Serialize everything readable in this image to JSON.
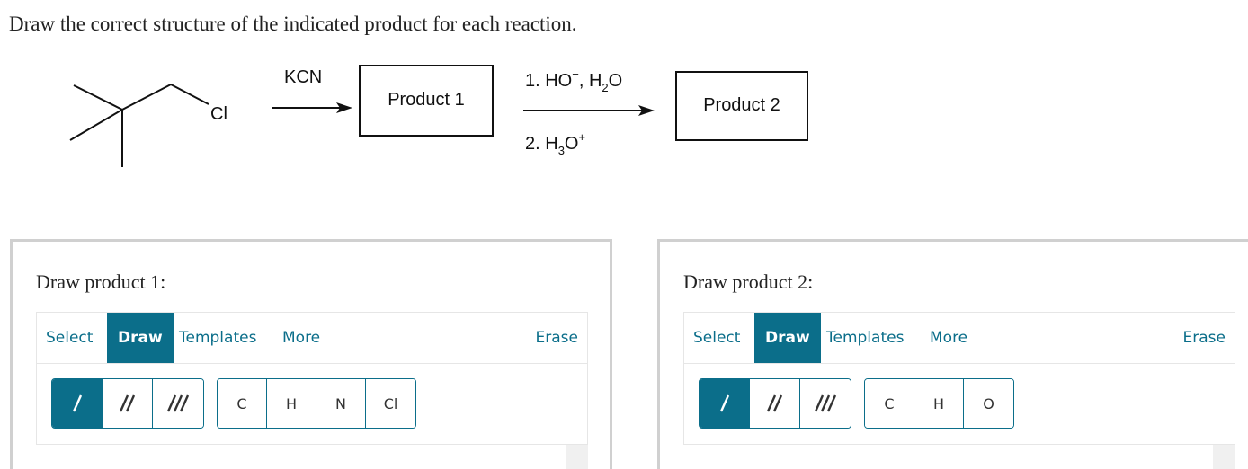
{
  "question": "Draw the correct structure of the indicated product for each reaction.",
  "scheme": {
    "reagent1": "KCN",
    "product1_label": "Product 1",
    "step1_prefix": "1. HO",
    "step1_charge": "−",
    "step1_mid": ", H",
    "step1_sub": "2",
    "step1_end": "O",
    "step2_prefix": "2. H",
    "step2_sub": "3",
    "step2_end": "O",
    "step2_charge": "+",
    "product2_label": "Product 2",
    "chlorine": "Cl"
  },
  "panel1": {
    "title": "Draw product 1:",
    "tabs": {
      "select": "Select",
      "draw": "Draw",
      "templates": "Templates",
      "more": "More",
      "erase": "Erase"
    },
    "atoms": [
      "C",
      "H",
      "N",
      "Cl"
    ]
  },
  "panel2": {
    "title": "Draw product 2:",
    "tabs": {
      "select": "Select",
      "draw": "Draw",
      "templates": "Templates",
      "more": "More",
      "erase": "Erase"
    },
    "atoms": [
      "C",
      "H",
      "O"
    ]
  },
  "colors": {
    "accent": "#0b6e8a",
    "border": "#d0d0d0"
  },
  "icons": [
    "single-bond-icon",
    "double-bond-icon",
    "triple-bond-icon"
  ]
}
